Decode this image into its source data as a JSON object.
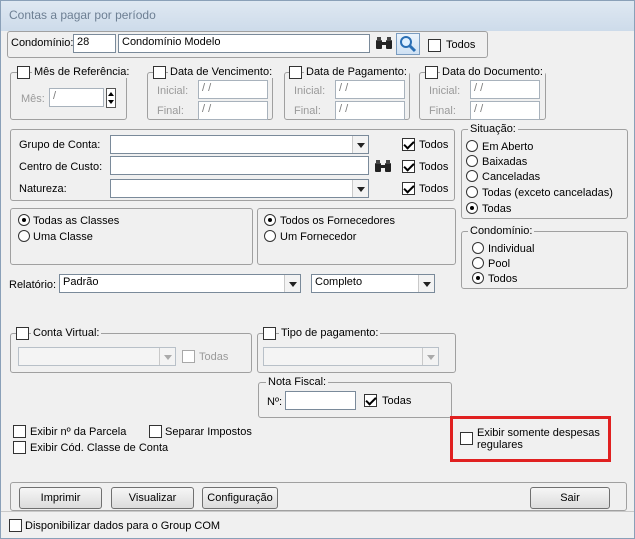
{
  "window": {
    "title": "Contas a pagar por período"
  },
  "condominio": {
    "label": "Condomínio:",
    "code": "28",
    "name": "Condomínio Modelo",
    "todos_label": "Todos"
  },
  "mes_ref": {
    "title": "Mês de Referência:",
    "mes_label": "Mês:",
    "value": " /"
  },
  "data_venc": {
    "title": "Data de Vencimento:",
    "inicial_label": "Inicial:",
    "final_label": "Final:",
    "inicial": " / /",
    "final": " / /"
  },
  "data_pag": {
    "title": "Data de Pagamento:",
    "inicial_label": "Inicial:",
    "final_label": "Final:",
    "inicial": " / /",
    "final": " / /"
  },
  "data_doc": {
    "title": "Data do Documento:",
    "inicial_label": "Inicial:",
    "final_label": "Final:",
    "inicial": " / /",
    "final": " / /"
  },
  "filtros": {
    "grupo_label": "Grupo de Conta:",
    "centro_label": "Centro de Custo:",
    "natureza_label": "Natureza:",
    "todos_label": "Todos"
  },
  "situacao": {
    "title": "Situação:",
    "options": [
      "Em Aberto",
      "Baixadas",
      "Canceladas",
      "Todas (exceto canceladas)",
      "Todas"
    ],
    "selected": "Todas"
  },
  "classes": {
    "options": [
      "Todas as Classes",
      "Uma Classe"
    ]
  },
  "fornecedores": {
    "options": [
      "Todos os Fornecedores",
      "Um Fornecedor"
    ]
  },
  "cond_tipo": {
    "title": "Condomínio:",
    "options": [
      "Individual",
      "Pool",
      "Todos"
    ],
    "selected": "Todos"
  },
  "relatorio": {
    "label": "Relatório:",
    "value": "Padrão",
    "mode": "Completo"
  },
  "conta_virtual": {
    "title": "Conta Virtual:",
    "todas_label": "Todas"
  },
  "tipo_pag": {
    "title": "Tipo de pagamento:"
  },
  "nota_fiscal": {
    "title": "Nota Fiscal:",
    "num_label": "Nº:",
    "todas_label": "Todas"
  },
  "opcoes": {
    "parcela": "Exibir nº da Parcela",
    "separar": "Separar Impostos",
    "cod_classe": "Exibir Cód. Classe de Conta",
    "despesas": "Exibir somente despesas regulares"
  },
  "buttons": {
    "imprimir": "Imprimir",
    "visualizar": "Visualizar",
    "configuracao": "Configuração",
    "sair": "Sair"
  },
  "footer": {
    "group_com": "Disponibilizar dados para o Group COM"
  }
}
